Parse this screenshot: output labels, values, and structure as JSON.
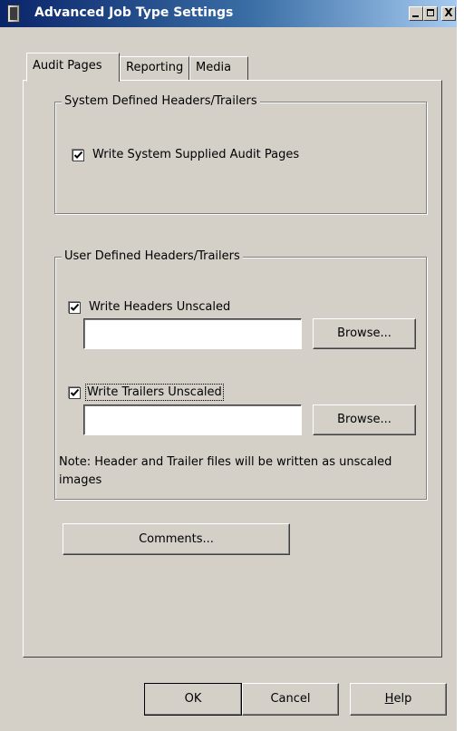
{
  "window": {
    "title": "Advanced Job Type Settings",
    "controls": {
      "minimize": "minimize",
      "maximize": "maximize",
      "close": "X"
    }
  },
  "tabs": [
    {
      "label": "Audit Pages",
      "active": true
    },
    {
      "label": "Reporting",
      "active": false
    },
    {
      "label": "Media",
      "active": false
    }
  ],
  "system_group": {
    "title": "System Defined Headers/Trailers",
    "write_system_checkbox": {
      "label": "Write System Supplied Audit Pages",
      "checked": true
    }
  },
  "user_group": {
    "title": "User Defined Headers/Trailers",
    "headers": {
      "label": "Write Headers Unscaled",
      "checked": true,
      "value": "",
      "browse_label": "Browse..."
    },
    "trailers": {
      "label": "Write Trailers Unscaled",
      "checked": true,
      "value": "",
      "browse_label": "Browse..."
    },
    "note": "Note: Header and Trailer files will be written as unscaled images"
  },
  "comments_button": "Comments...",
  "footer": {
    "ok": "OK",
    "cancel": "Cancel",
    "help": "Help",
    "help_mnemonic": "H"
  }
}
